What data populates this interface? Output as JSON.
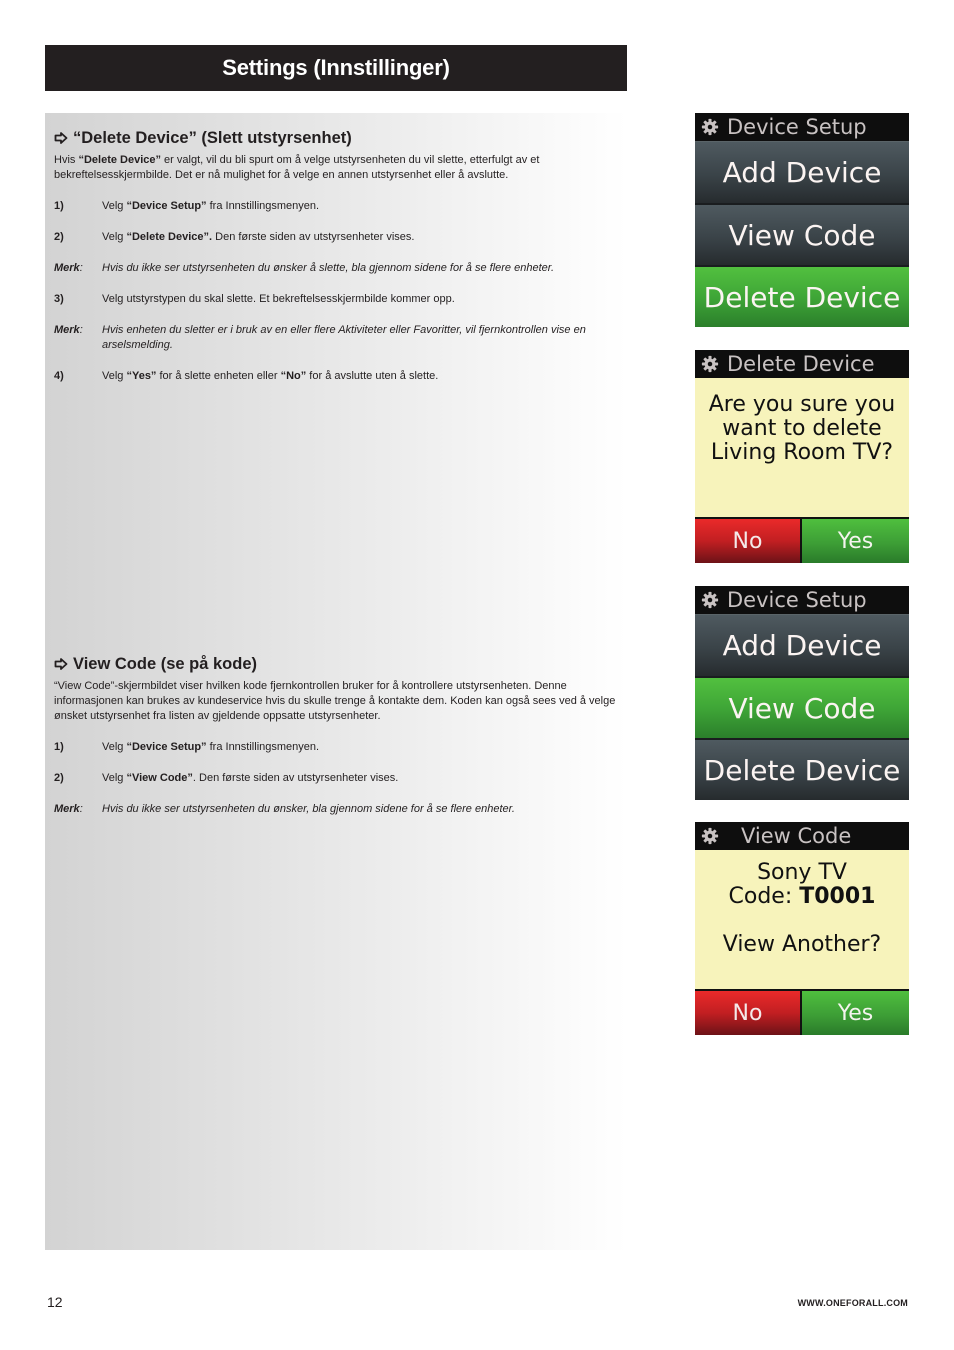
{
  "header": {
    "title": "Settings (Innstillinger)"
  },
  "sections": {
    "delete": {
      "heading": "“Delete Device” (Slett utstyrsenhet)",
      "intro_pre": "Hvis ",
      "intro_bold": "“Delete Device”",
      "intro_post": " er valgt, vil du bli spurt om å velge utstyrsenheten du vil slette, etterfulgt av et bekreftelsesskjermbilde. Det er nå mulighet for å velge en annen utstyrsenhet eller å avslutte.",
      "step1": {
        "num": "1)",
        "pre": "Velg ",
        "bold": "“Device Setup”",
        "post": " fra Innstillingsmenyen."
      },
      "step2": {
        "num": "2)",
        "pre": "Velg ",
        "bold": "“Delete Device”.",
        "post": " Den første siden av utstyrsenheter vises."
      },
      "note1": {
        "label": "Merk",
        "colon": ":",
        "text": "Hvis du ikke ser utstyrsenheten du ønsker å slette, bla gjennom sidene for å se flere enheter."
      },
      "step3": {
        "num": "3)",
        "text": "Velg utstyrstypen du skal slette. Et bekreftelsesskjermbilde kommer opp."
      },
      "note2": {
        "label": "Merk",
        "colon": ":",
        "text": "Hvis enheten du sletter er i bruk av en eller flere Aktiviteter eller Favoritter, vil fjernkontrollen vise en arselsmelding."
      },
      "step4": {
        "num": "4)",
        "pre": "Velg ",
        "bold1": "“Yes”",
        "mid": " for å slette enheten eller ",
        "bold2": "“No”",
        "post": " for å avslutte uten å slette."
      }
    },
    "view": {
      "heading": "View Code (se på kode)",
      "intro": "“View Code”-skjermbildet viser hvilken kode fjernkontrollen bruker for å kontrollere utstyrsenheten. Denne informasjonen kan brukes av kundeservice hvis du skulle trenge å kontakte dem.  Koden kan også sees ved å velge ønsket utstyrsenhet fra listen av gjeldende oppsatte utstyrsenheter.",
      "step1": {
        "num": "1)",
        "pre": "Velg ",
        "bold": "“Device Setup”",
        "post": " fra Innstillingsmenyen."
      },
      "step2": {
        "num": "2)",
        "pre": "Velg ",
        "bold": "“View Code”",
        "post": ". Den første siden av utstyrsenheter vises."
      },
      "note1": {
        "label": "Merk",
        "colon": ":",
        "text": "Hvis du ikke ser utstyrsenheten du ønsker, bla gjennom sidene for å se flere enheter."
      }
    }
  },
  "screens": {
    "setup1": {
      "icon": "gear-icon",
      "title": "Device Setup",
      "items": [
        "Add Device",
        "View Code",
        "Delete Device"
      ],
      "selected": "Delete Device"
    },
    "confirm_delete": {
      "icon": "gear-icon",
      "title": "Delete Device",
      "lines": [
        "Are you sure you",
        "want to delete",
        "Living Room TV?"
      ],
      "no": "No",
      "yes": "Yes"
    },
    "setup2": {
      "icon": "gear-icon",
      "title": "Device Setup",
      "items": [
        "Add Device",
        "View Code",
        "Delete Device"
      ],
      "selected": "View Code"
    },
    "view_code": {
      "icon": "gear-icon",
      "title": "View Code",
      "device": "Sony TV",
      "code_label": "Code: ",
      "code": "T0001",
      "question": "View Another?",
      "no": "No",
      "yes": "Yes"
    }
  },
  "colors": {
    "selected_green": "#3fa637",
    "no_red": "#c21f22",
    "message_bg": "#f7f3bb",
    "header_bar": "#231f20"
  },
  "footer": {
    "page_number": "12",
    "url": "WWW.ONEFORALL.COM"
  }
}
